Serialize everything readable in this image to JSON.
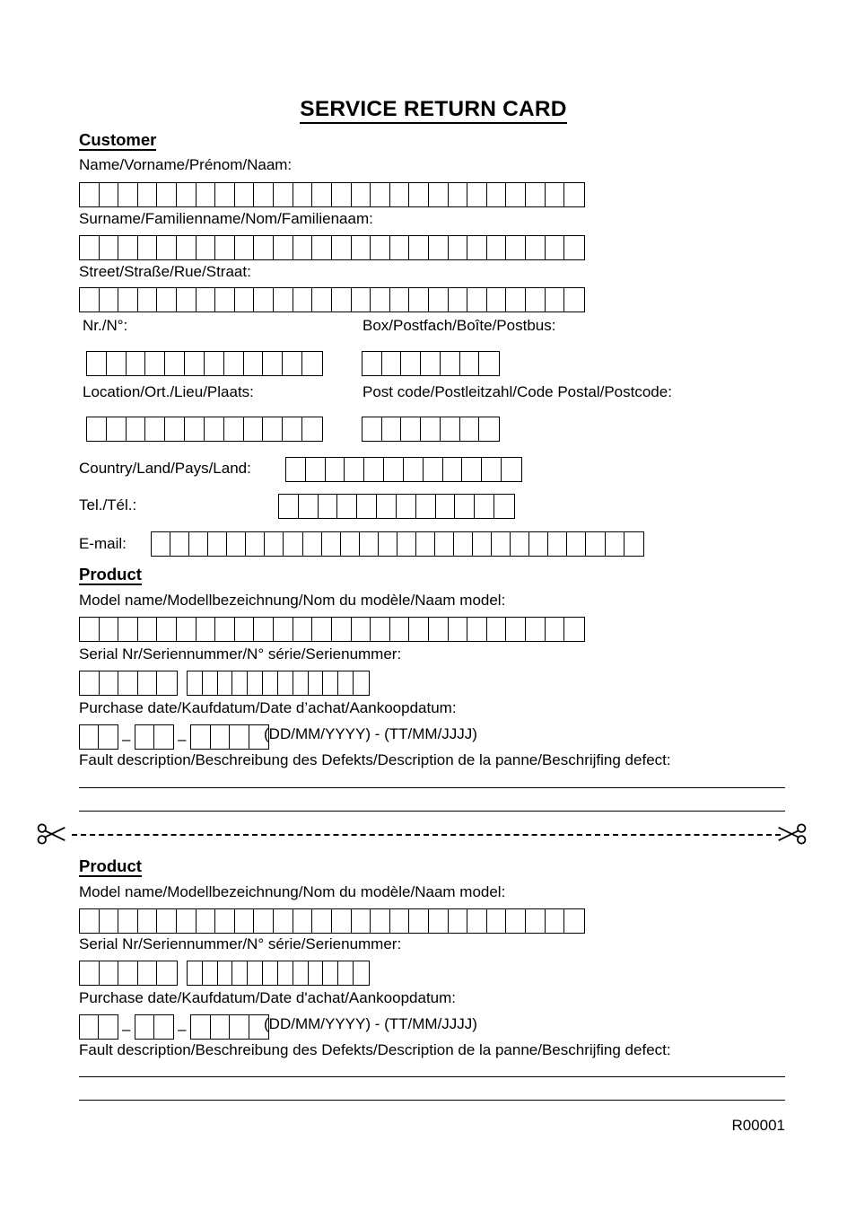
{
  "document": {
    "title": "SERVICE RETURN CARD",
    "footer_code": "R00001"
  },
  "customer": {
    "heading": "Customer",
    "fields": {
      "name_label": "Name/Vorname/Prénom/Naam:",
      "name_cells": 26,
      "surname_label": "Surname/Familienname/Nom/Familienaam:",
      "surname_cells": 26,
      "street_label": "Street/Straße/Rue/Straat:",
      "street_cells": 26,
      "number_label": "Nr./N°:",
      "number_cells": 12,
      "box_label": "Box/Postfach/Boîte/Postbus:",
      "box_cells": 7,
      "location_label": "Location/Ort./Lieu/Plaats:",
      "location_cells": 12,
      "postcode_label": "Post code/Postleitzahl/Code Postal/Postcode:",
      "postcode_cells": 7,
      "country_label": "Country/Land/Pays/Land:",
      "country_cells": 12,
      "tel_label": "Tel./Tél.:",
      "tel_cells": 12,
      "email_label": "E-mail:",
      "email_cells": 26
    }
  },
  "product_top": {
    "heading": "Product",
    "model_label": "Model name/Modellbezeichnung/Nom du modèle/Naam model:",
    "model_cells": 26,
    "serial_label": "Serial Nr/Seriennummer/N° série/Serienummer:",
    "serial_cells_group1": 5,
    "serial_cells_group2": 12,
    "purchase_label": "Purchase date/Kaufdatum/Date d’achat/Aankoopdatum:",
    "date_day_cells": 2,
    "date_month_cells": 2,
    "date_year_cells": 4,
    "date_separator": "–",
    "date_format_hint": "(DD/MM/YYYY) - (TT/MM/JJJJ)",
    "fault_label": "Fault description/Beschreibung des Defekts/Description de la panne/Beschrijfing defect:",
    "fault_lines": 2
  },
  "product_bottom": {
    "heading": "Product",
    "model_label": "Model name/Modellbezeichnung/Nom du modèle/Naam model:",
    "model_cells": 26,
    "serial_label": "Serial Nr/Seriennummer/N° série/Serienummer:",
    "serial_cells_group1": 5,
    "serial_cells_group2": 12,
    "purchase_label": "Purchase date/Kaufdatum/Date d'achat/Aankoopdatum:",
    "date_day_cells": 2,
    "date_month_cells": 2,
    "date_year_cells": 4,
    "date_separator": "–",
    "date_format_hint": "(DD/MM/YYYY) - (TT/MM/JJJJ)",
    "fault_label": "Fault description/Beschreibung des Defekts/Description de la panne/Beschrijfing defect:",
    "fault_lines": 2
  },
  "cut_separator": {
    "icon_left": "scissors-icon",
    "icon_right": "scissors-icon"
  },
  "colors": {
    "ink": "#000000",
    "paper": "#ffffff"
  }
}
